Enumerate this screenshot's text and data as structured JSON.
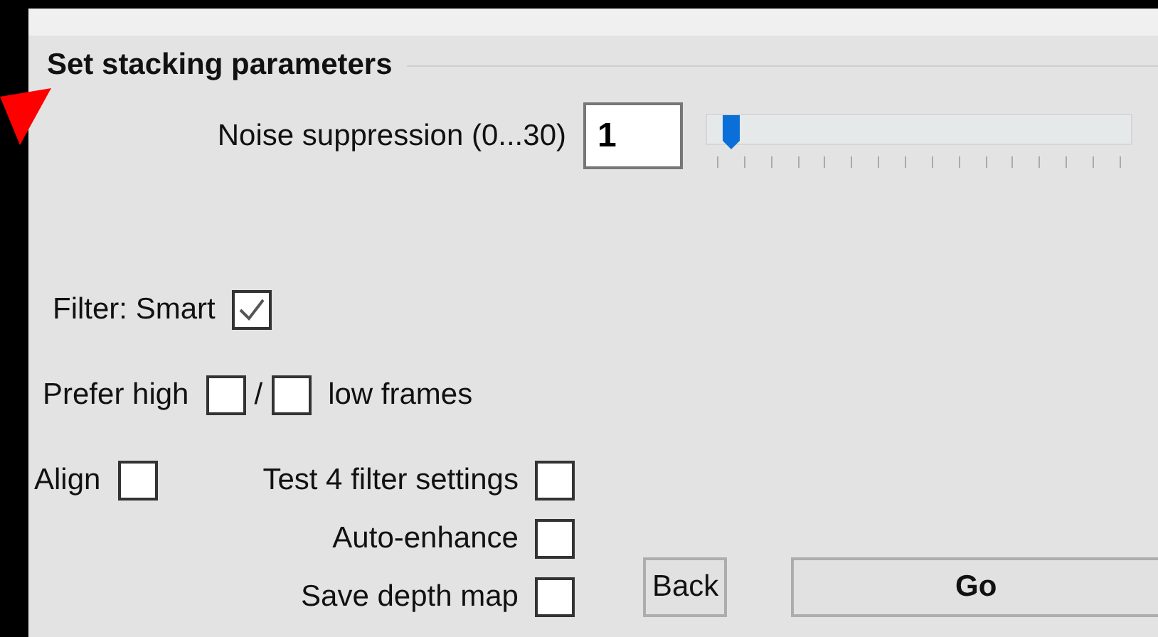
{
  "title": "Set stacking parameters",
  "noise": {
    "label": "Noise suppression (0...30)",
    "value": "1",
    "level": 0.033
  },
  "filter": {
    "label": "Filter: Smart",
    "checked": true
  },
  "prefer": {
    "label": "Prefer high",
    "high_checked": false,
    "separator": "/",
    "low_checked": false,
    "label_after": "low frames"
  },
  "align": {
    "label": "Align",
    "checked": false
  },
  "options": [
    {
      "label": "Test 4 filter settings",
      "checked": false
    },
    {
      "label": "Auto-enhance",
      "checked": false
    },
    {
      "label": "Save depth map",
      "checked": false
    }
  ],
  "buttons": [
    {
      "label": "Back",
      "kind": "normal"
    },
    {
      "label": "Go",
      "kind": "default"
    }
  ]
}
